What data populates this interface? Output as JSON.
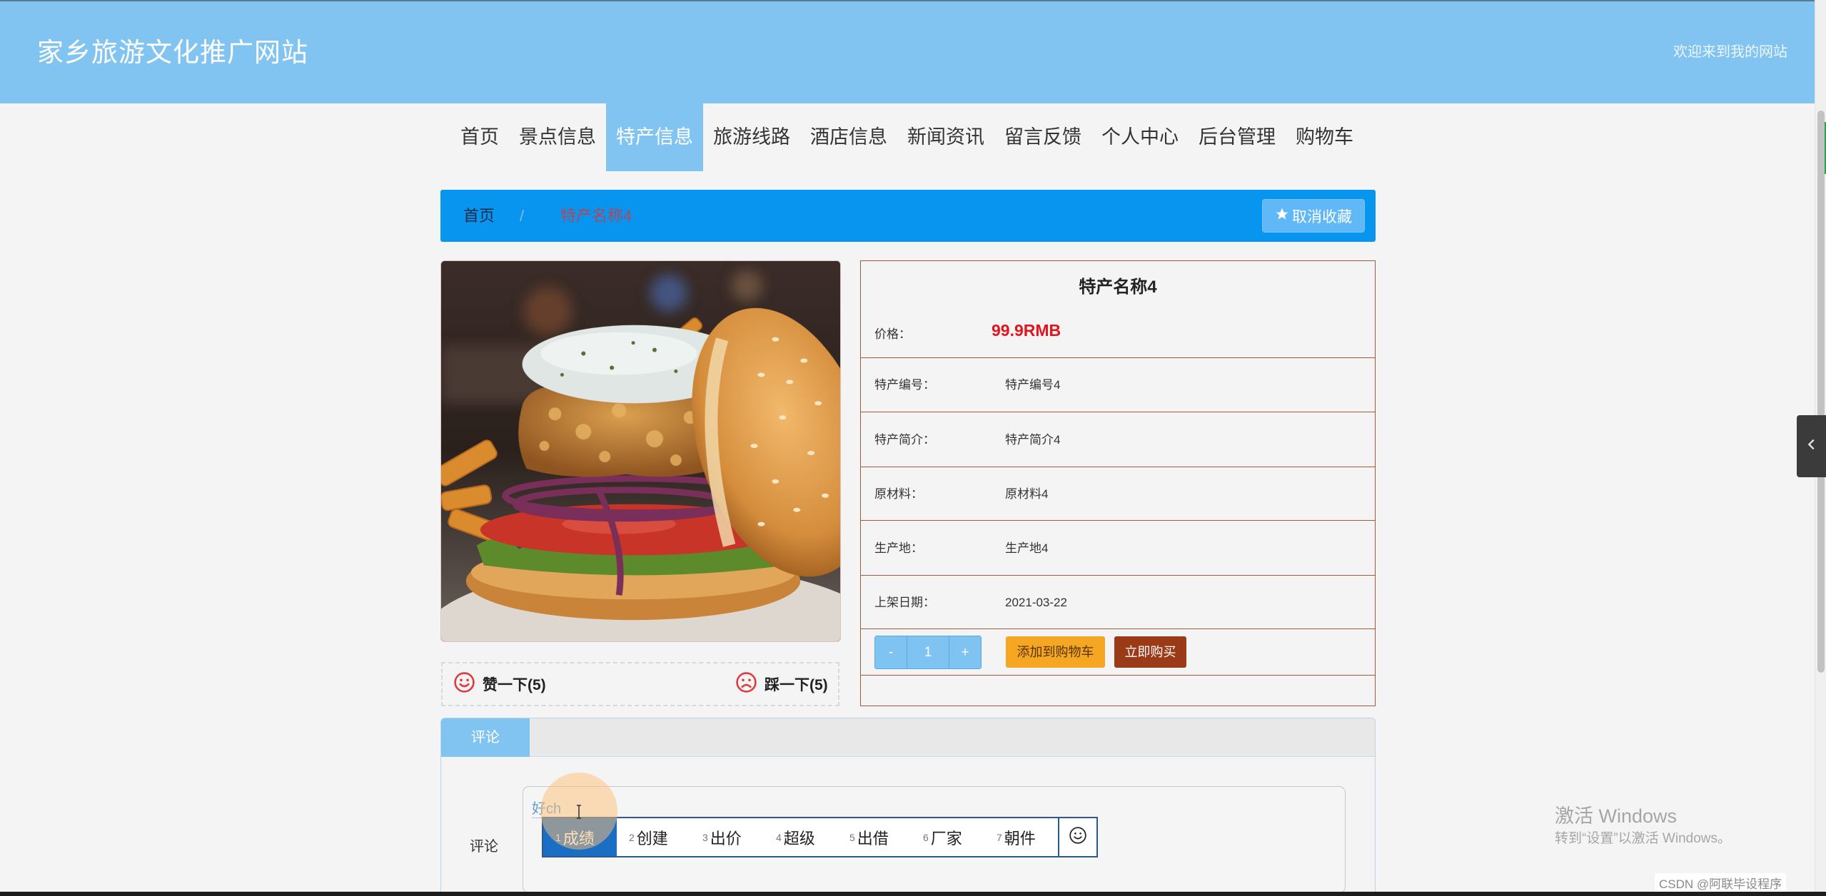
{
  "header": {
    "site_title": "家乡旅游文化推广网站",
    "welcome": "欢迎来到我的网站"
  },
  "nav": {
    "items": [
      {
        "label": "首页"
      },
      {
        "label": "景点信息"
      },
      {
        "label": "特产信息"
      },
      {
        "label": "旅游线路"
      },
      {
        "label": "酒店信息"
      },
      {
        "label": "新闻资讯"
      },
      {
        "label": "留言反馈"
      },
      {
        "label": "个人中心"
      },
      {
        "label": "后台管理"
      },
      {
        "label": "购物车"
      }
    ],
    "active_index": 2
  },
  "breadcrumb": {
    "home": "首页",
    "separator": "/",
    "current": "特产名称4"
  },
  "favorite_button": {
    "icon": "star-icon",
    "label": "取消收藏"
  },
  "product": {
    "name": "特产名称4",
    "price_label": "价格：",
    "price": "99.9RMB",
    "fields": [
      {
        "label": "特产编号：",
        "value": "特产编号4"
      },
      {
        "label": "特产简介：",
        "value": "特产简介4"
      },
      {
        "label": "原材料：",
        "value": "原材料4"
      },
      {
        "label": "生产地：",
        "value": "生产地4"
      },
      {
        "label": "上架日期：",
        "value": "2021-03-22"
      }
    ],
    "quantity": {
      "minus": "-",
      "value": "1",
      "plus": "+"
    },
    "add_to_cart": "添加到购物车",
    "buy_now": "立即购买"
  },
  "votes": {
    "like": {
      "icon": "smile-icon",
      "label": "赞一下(5)"
    },
    "dislike": {
      "icon": "frown-icon",
      "label": "踩一下(5)"
    }
  },
  "comments": {
    "tab": "评论",
    "field_label": "评论",
    "input_text": "好ch"
  },
  "ime": {
    "candidates": [
      {
        "index": "1",
        "word": "成绩"
      },
      {
        "index": "2",
        "word": "创建"
      },
      {
        "index": "3",
        "word": "出价"
      },
      {
        "index": "4",
        "word": "超级"
      },
      {
        "index": "5",
        "word": "出借"
      },
      {
        "index": "6",
        "word": "厂家"
      },
      {
        "index": "7",
        "word": "朝件"
      }
    ],
    "selected_index": 0,
    "emoji_icon": "smiley-icon"
  },
  "side_tab": {
    "icon": "chevron-left-icon"
  },
  "watermarks": {
    "activate_title": "激活 Windows",
    "activate_hint": "转到“设置”以激活 Windows。",
    "csdn": "CSDN @阿联毕设程序"
  },
  "colors": {
    "header": "#82c4f1",
    "breadcrumb": "#0795ef",
    "price": "#e4141c",
    "add_to_cart": "#f5a623",
    "buy_now": "#9b3a17",
    "table_border": "#9d5b3e",
    "ime_highlight": "#1a6fc4"
  }
}
